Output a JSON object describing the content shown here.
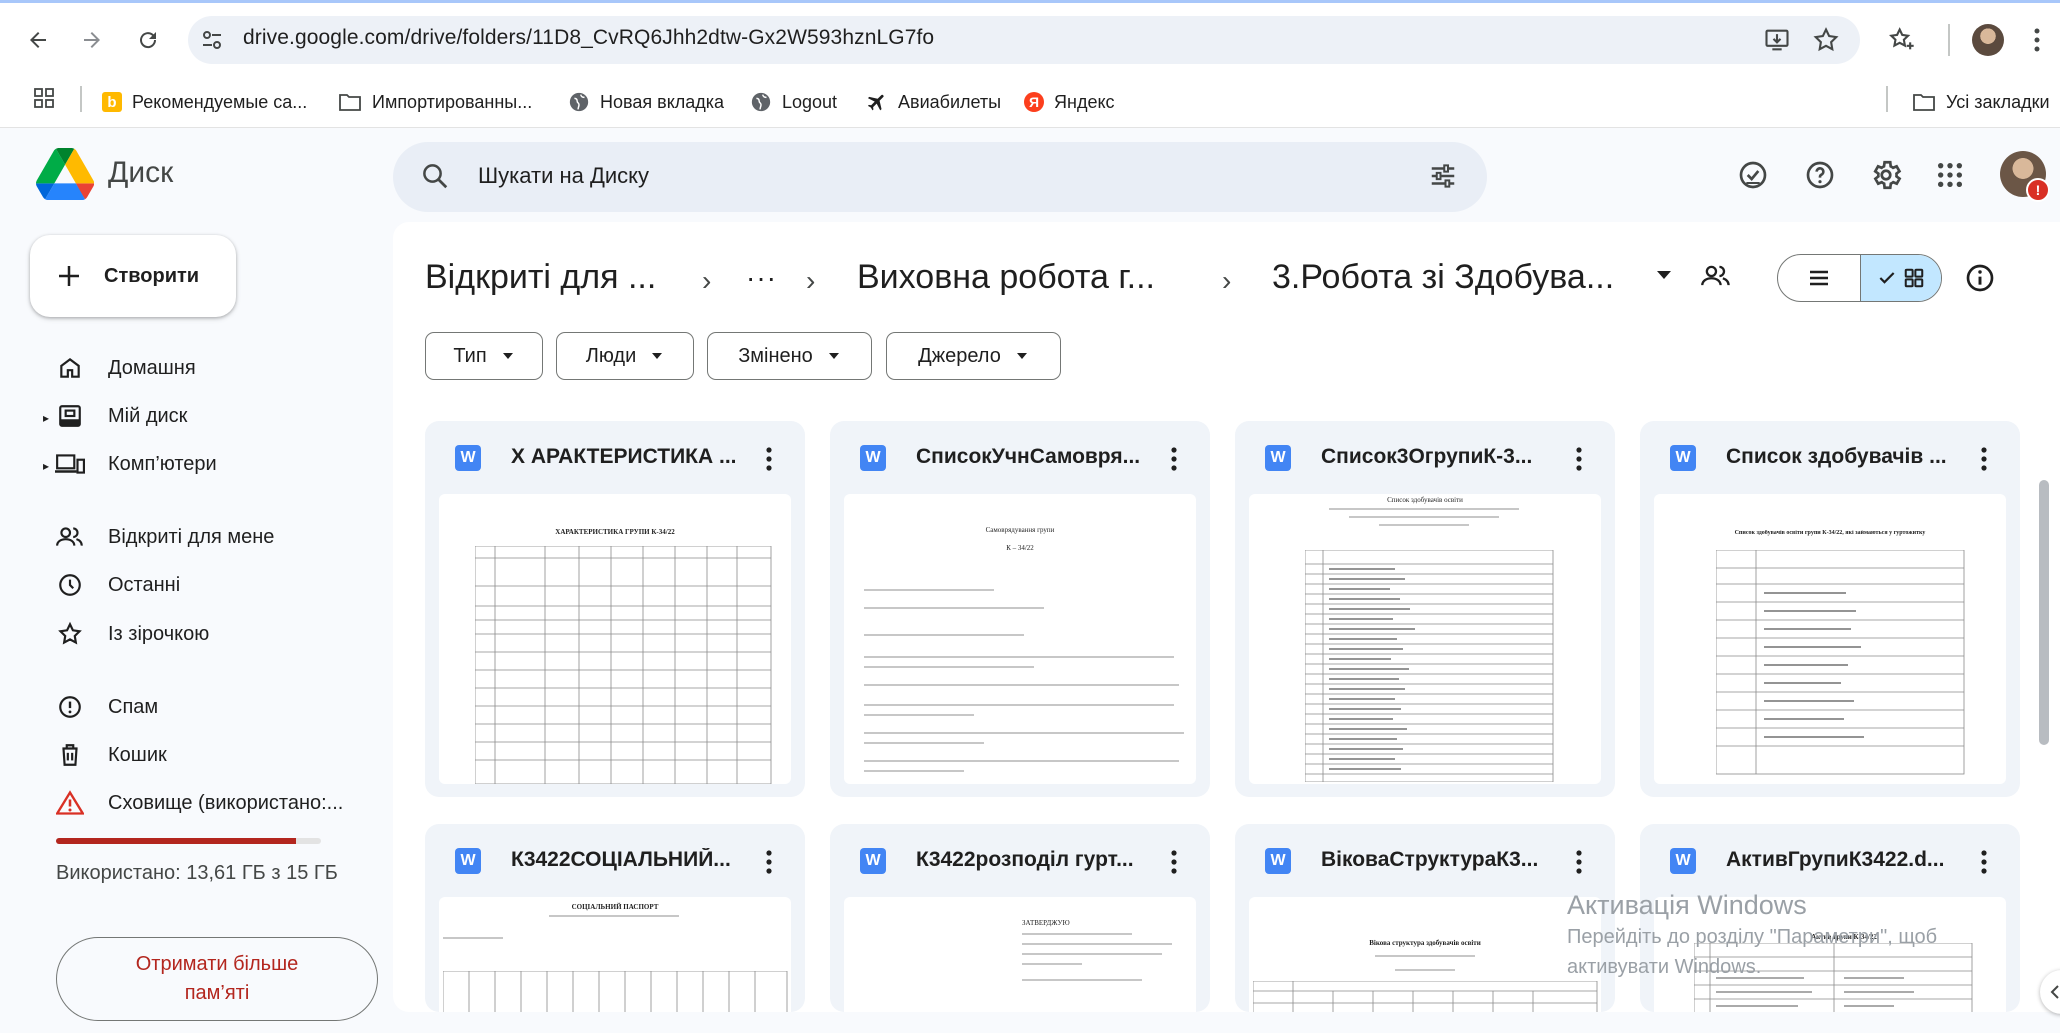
{
  "browser": {
    "url": "drive.google.com/drive/folders/11D8_CvRQ6Jhh2dtw-Gx2W593hznLG7fo",
    "bookmarks": [
      {
        "label": "Рекомендуемые са...",
        "icon": "bing-icon"
      },
      {
        "label": "Импортированны...",
        "icon": "folder-icon"
      },
      {
        "label": "Новая вкладка",
        "icon": "globe-icon"
      },
      {
        "label": "Logout",
        "icon": "globe-icon"
      },
      {
        "label": "Авиабилеты",
        "icon": "plane-icon"
      },
      {
        "label": "Яндекс",
        "icon": "yandex-icon"
      }
    ],
    "all_bookmarks": "Усі закладки"
  },
  "drive": {
    "app_name": "Диск",
    "search_placeholder": "Шукати на Диску",
    "create_label": "Створити",
    "sidebar": [
      {
        "label": "Домашня",
        "icon": "home-icon"
      },
      {
        "label": "Мій диск",
        "icon": "drive-icon"
      },
      {
        "label": "Комп’ютери",
        "icon": "computer-icon"
      },
      {
        "label": "Відкриті для мене",
        "icon": "shared-icon"
      },
      {
        "label": "Останні",
        "icon": "clock-icon"
      },
      {
        "label": "Із зірочкою",
        "icon": "star-icon"
      },
      {
        "label": "Спам",
        "icon": "spam-icon"
      },
      {
        "label": "Кошик",
        "icon": "trash-icon"
      },
      {
        "label": "Сховище (використано:...",
        "icon": "warning-icon"
      }
    ],
    "storage": {
      "used_text": "Використано: 13,61 ГБ з 15 ГБ",
      "used_fraction": 0.907,
      "more_button": "Отримати більше пам’яті"
    },
    "breadcrumb": {
      "item1": "Відкриті для ...",
      "ellipsis": "···",
      "item2": "Виховна робота г...",
      "current": "3.Робота зі Здобува..."
    },
    "filters": [
      "Тип",
      "Люди",
      "Змінено",
      "Джерело"
    ],
    "files": [
      {
        "name": "Х АРАКТЕРИСТИКА ..."
      },
      {
        "name": "СписокУчнСамовря..."
      },
      {
        "name": "Список3ОгрупиК-3..."
      },
      {
        "name": "Список здобувачів ..."
      },
      {
        "name": "К3422СОЦІАЛЬНИЙ..."
      },
      {
        "name": "К3422розподіл гурт..."
      },
      {
        "name": "ВіковаСтруктураК3..."
      },
      {
        "name": "АктивГрупиК3422.d..."
      }
    ],
    "thumb_text": {
      "t1": "ХАРАКТЕРИСТИКА ГРУПИ К-34/22",
      "t2a": "Самоврядування групи",
      "t2b": "К – 34/22",
      "t3": "Список здобувачів освіти",
      "t4": "Список здобувачів освіти групи К-34/22, які займаються у гуртожитку",
      "t5": "СОЦІАЛЬНИЙ ПАСПОРТ",
      "t6": "ЗАТВЕРДЖУЮ",
      "t7": "Вікова структура здобувачів освіти",
      "t8": "Актив групи К-34/22"
    }
  },
  "watermark": {
    "title": "Активація Windows",
    "line1": "Перейдіть до розділу \"Параметри\", щоб",
    "line2": "активувати Windows."
  }
}
